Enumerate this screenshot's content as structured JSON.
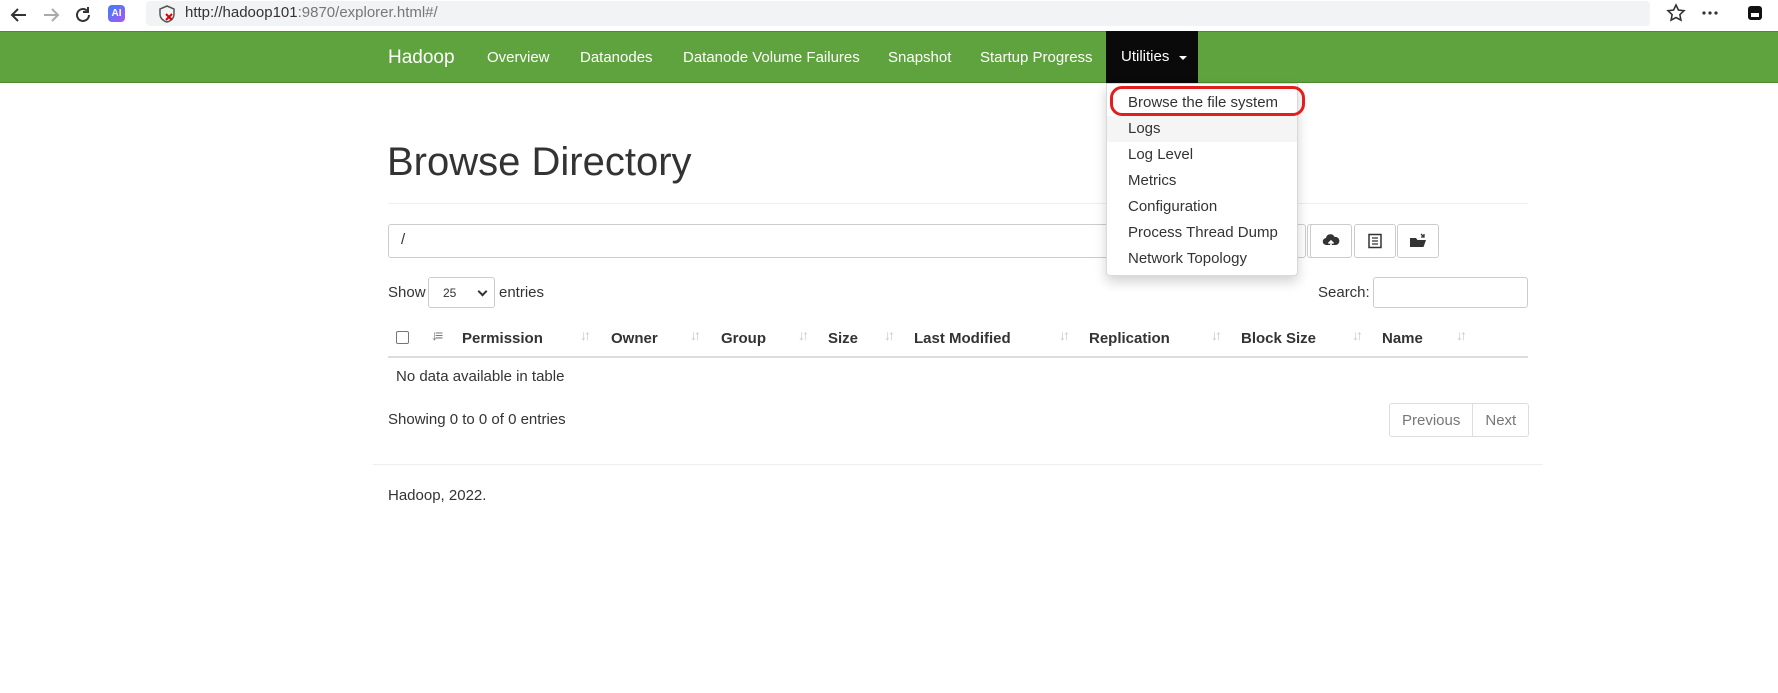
{
  "browser": {
    "url_host": "http://hadoop101",
    "url_rest": ":9870/explorer.html#/",
    "ai_badge": "AI"
  },
  "navbar": {
    "brand": "Hadoop",
    "links": [
      "Overview",
      "Datanodes",
      "Datanode Volume Failures",
      "Snapshot",
      "Startup Progress"
    ],
    "utilities": "Utilities",
    "accent": "#5fa33e"
  },
  "dropdown": {
    "items": [
      "Browse the file system",
      "Logs",
      "Log Level",
      "Metrics",
      "Configuration",
      "Process Thread Dump",
      "Network Topology"
    ],
    "highlight_color": "#e21f1f"
  },
  "page": {
    "title": "Browse Directory",
    "directory": "/",
    "show_label": "Show",
    "entries_value": "25",
    "entries_label": "entries",
    "search_label": "Search:",
    "columns": [
      "Permission",
      "Owner",
      "Group",
      "Size",
      "Last Modified",
      "Replication",
      "Block Size",
      "Name"
    ],
    "empty_message": "No data available in table",
    "showing": "Showing 0 to 0 of 0 entries",
    "previous": "Previous",
    "next": "Next",
    "footer": "Hadoop, 2022."
  }
}
